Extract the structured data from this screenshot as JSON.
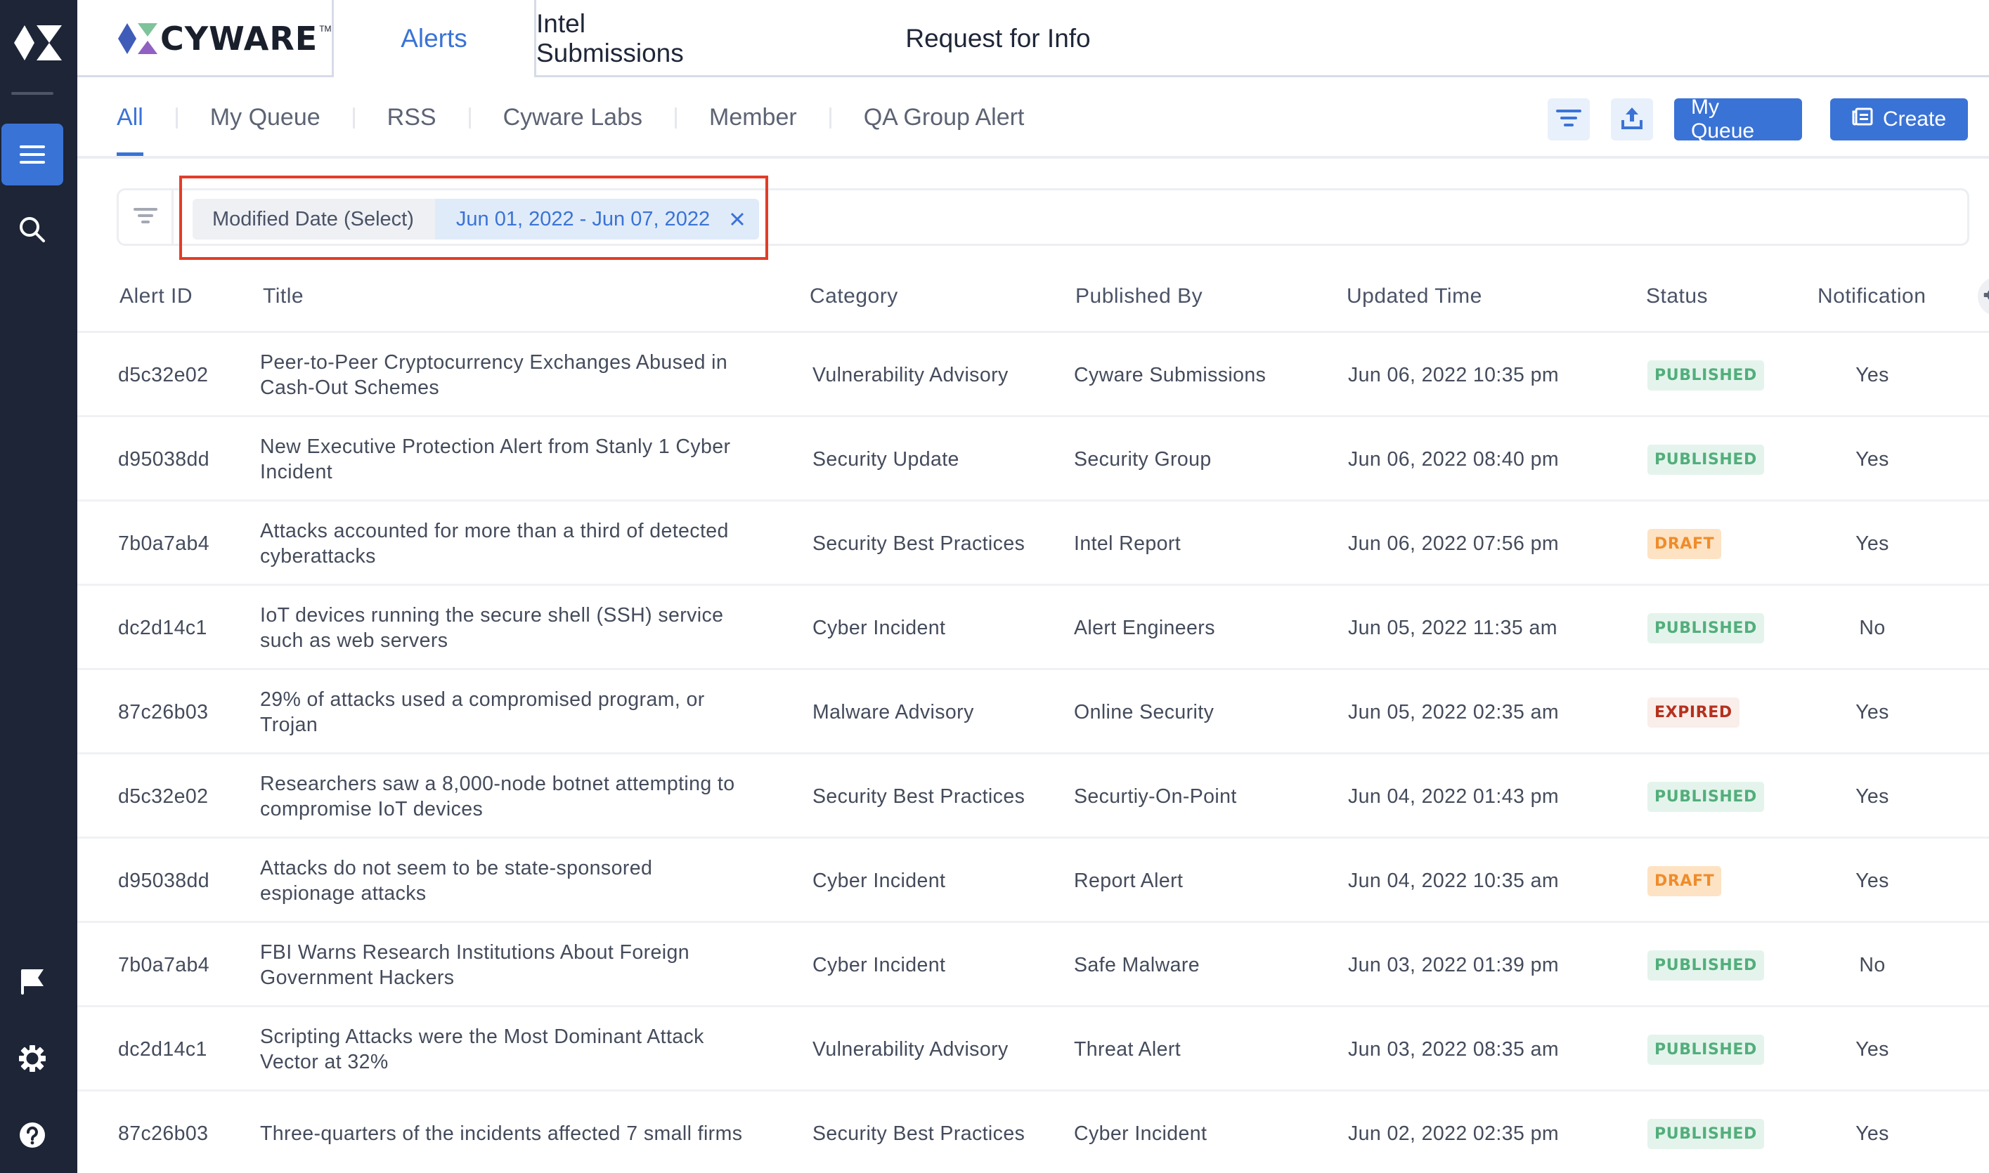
{
  "app": {
    "brand": "CYWARE",
    "trademark": "TM"
  },
  "sidebar": {
    "items": [
      {
        "name": "menu",
        "icon": "hamburger-menu-icon",
        "active": true
      },
      {
        "name": "search",
        "icon": "search-icon",
        "active": false
      },
      {
        "name": "flag",
        "icon": "flag-icon",
        "active": false
      },
      {
        "name": "settings",
        "icon": "gear-icon",
        "active": false
      },
      {
        "name": "help",
        "icon": "help-circle-icon",
        "active": false
      }
    ]
  },
  "header": {
    "tabs": [
      {
        "label": "Alerts",
        "active": true
      },
      {
        "label": "Intel Submissions",
        "active": false
      },
      {
        "label": "Request for Info",
        "active": false
      }
    ]
  },
  "subtabs": [
    {
      "label": "All",
      "active": true
    },
    {
      "label": "My Queue",
      "active": false
    },
    {
      "label": "RSS",
      "active": false
    },
    {
      "label": "Cyware Labs",
      "active": false
    },
    {
      "label": "Member",
      "active": false
    },
    {
      "label": "QA Group Alert",
      "active": false
    }
  ],
  "toolbar": {
    "filter_icon": "filter-icon",
    "export_icon": "upload-icon",
    "my_queue_label": "My Queue",
    "create_label": "Create",
    "create_icon": "newspaper-icon"
  },
  "filter": {
    "label": "Modified Date (Select)",
    "value": "Jun 01, 2022 - Jun 07, 2022",
    "remove_icon": "close-icon"
  },
  "table": {
    "columns": [
      "Alert ID",
      "Title",
      "Category",
      "Published By",
      "Updated Time",
      "Status",
      "Notification"
    ],
    "rows": [
      {
        "id": "d5c32e02",
        "title": "Peer-to-Peer Cryptocurrency Exchanges Abused in Cash-Out Schemes",
        "category": "Vulnerability Advisory",
        "published_by": "Cyware Submissions",
        "updated": "Jun 06, 2022 10:35 pm",
        "status": "PUBLISHED",
        "notification": "Yes"
      },
      {
        "id": "d95038dd",
        "title": "New Executive Protection Alert from Stanly 1 Cyber Incident",
        "category": "Security Update",
        "published_by": "Security Group",
        "updated": "Jun 06, 2022 08:40 pm",
        "status": "PUBLISHED",
        "notification": "Yes"
      },
      {
        "id": "7b0a7ab4",
        "title": "Attacks accounted for more than a third of detected cyberattacks",
        "category": "Security Best Practices",
        "published_by": "Intel Report",
        "updated": "Jun 06, 2022 07:56 pm",
        "status": "DRAFT",
        "notification": "Yes"
      },
      {
        "id": "dc2d14c1",
        "title": "IoT devices running the secure shell (SSH) service such as web servers",
        "category": "Cyber Incident",
        "published_by": "Alert Engineers",
        "updated": "Jun 05, 2022 11:35 am",
        "status": "PUBLISHED",
        "notification": "No"
      },
      {
        "id": "87c26b03",
        "title": "29% of attacks used a compromised program, or Trojan",
        "category": "Malware Advisory",
        "published_by": "Online Security",
        "updated": "Jun 05, 2022 02:35 am",
        "status": "EXPIRED",
        "notification": "Yes"
      },
      {
        "id": "d5c32e02",
        "title": "Researchers saw a 8,000-node botnet attempting to compromise IoT devices",
        "category": "Security Best Practices",
        "published_by": "Securtiy-On-Point",
        "updated": "Jun 04, 2022 01:43 pm",
        "status": "PUBLISHED",
        "notification": "Yes"
      },
      {
        "id": "d95038dd",
        "title": "Attacks do not seem to be state-sponsored espionage attacks",
        "category": "Cyber Incident",
        "published_by": "Report Alert",
        "updated": "Jun 04, 2022 10:35 am",
        "status": "DRAFT",
        "notification": "Yes"
      },
      {
        "id": "7b0a7ab4",
        "title": "FBI Warns Research Institutions About Foreign Government Hackers",
        "category": "Cyber Incident",
        "published_by": "Safe Malware",
        "updated": "Jun 03, 2022 01:39 pm",
        "status": "PUBLISHED",
        "notification": "No"
      },
      {
        "id": "dc2d14c1",
        "title": "Scripting Attacks were the Most Dominant Attack Vector at 32%",
        "category": "Vulnerability Advisory",
        "published_by": "Threat Alert",
        "updated": "Jun 03, 2022 08:35 am",
        "status": "PUBLISHED",
        "notification": "Yes"
      },
      {
        "id": "87c26b03",
        "title": "Three-quarters of the incidents affected 7 small firms",
        "category": "Security Best Practices",
        "published_by": "Cyber Incident",
        "updated": "Jun 02, 2022 02:35 pm",
        "status": "PUBLISHED",
        "notification": "Yes"
      }
    ],
    "column_settings_icon": "gear-icon"
  },
  "colors": {
    "accent": "#3a73d6",
    "sidebar": "#1d2537",
    "published": "#52ae7b",
    "draft": "#ef8c2b",
    "expired": "#b5311e",
    "highlight": "#e23d28"
  }
}
